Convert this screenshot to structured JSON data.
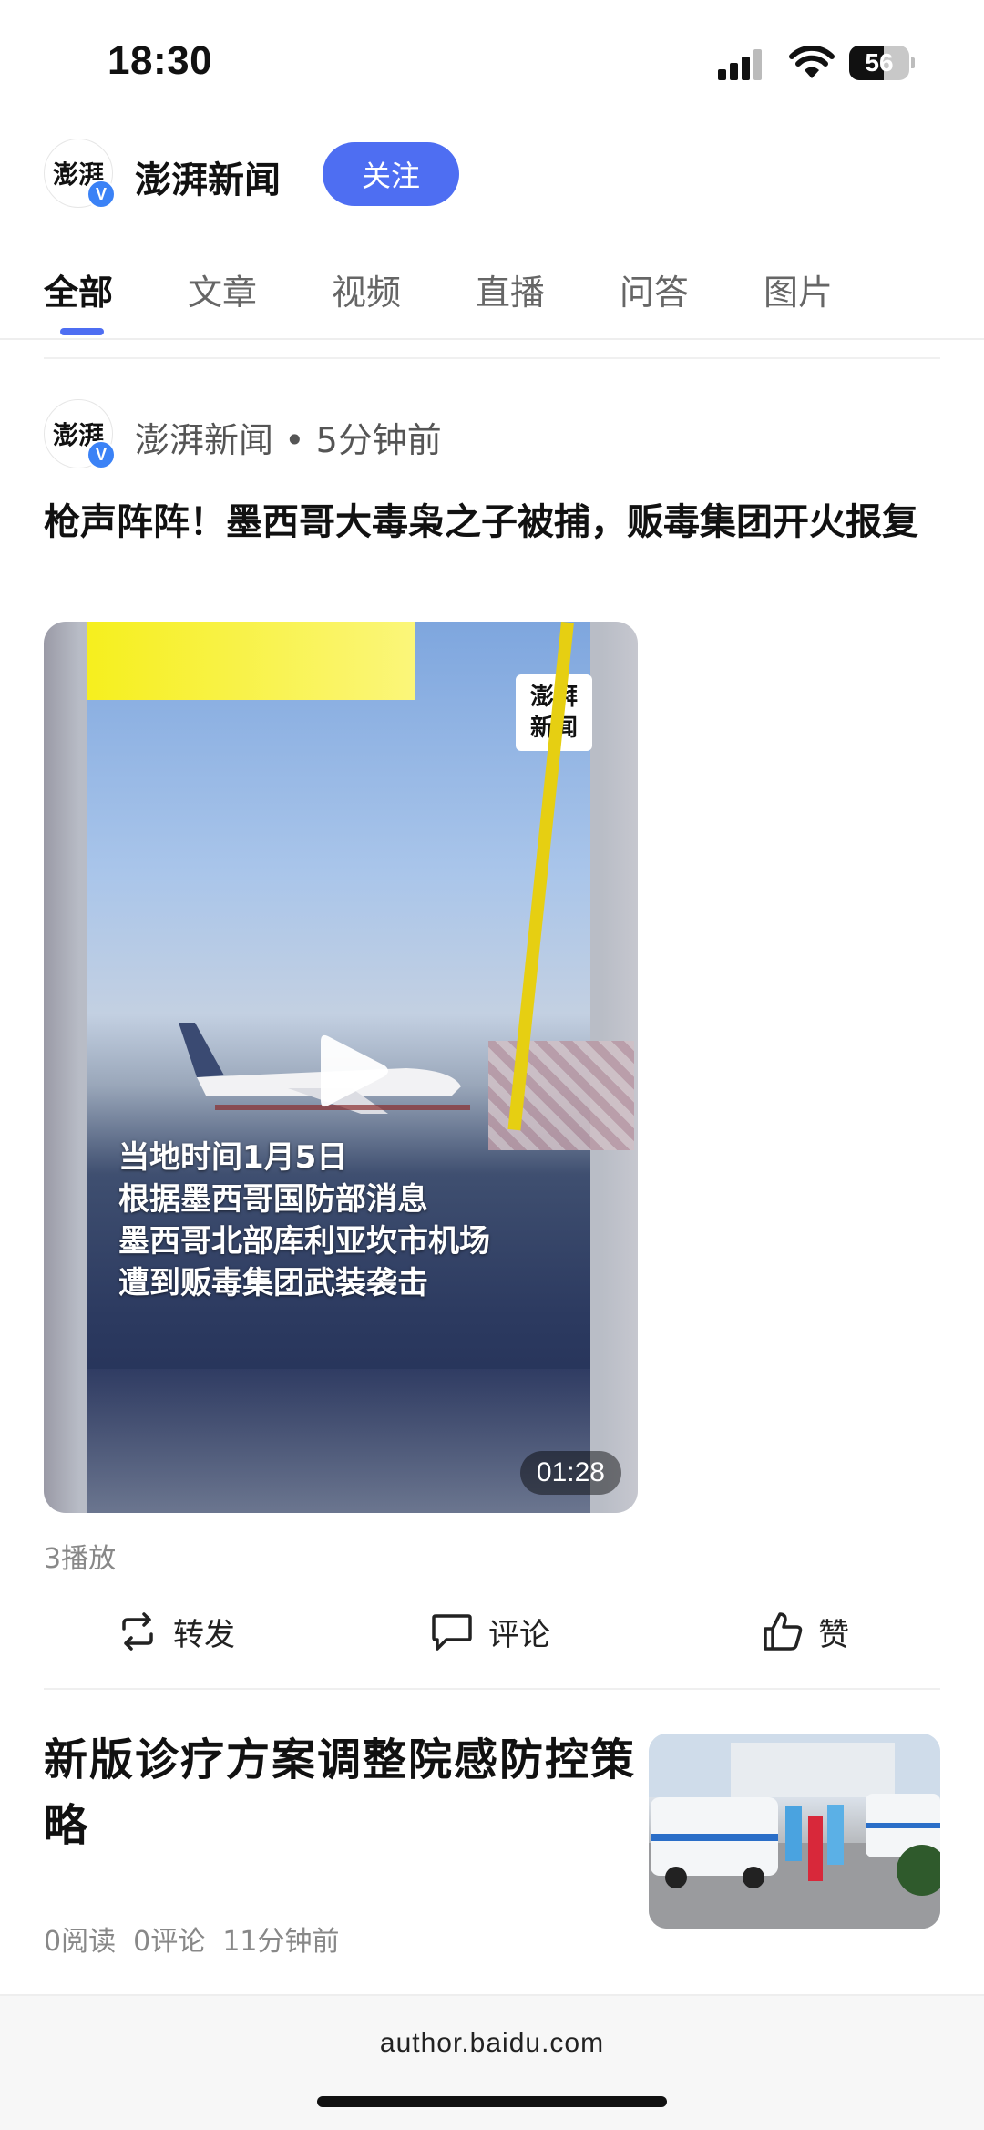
{
  "status_bar": {
    "time": "18:30",
    "battery": "56",
    "icons": [
      "signal-icon",
      "wifi-icon",
      "battery-icon"
    ]
  },
  "header": {
    "account_name": "澎湃新闻",
    "avatar_text": "澎湃",
    "follow_label": "关注"
  },
  "tabs": [
    {
      "label": "全部",
      "active": true
    },
    {
      "label": "文章",
      "active": false
    },
    {
      "label": "视频",
      "active": false
    },
    {
      "label": "直播",
      "active": false
    },
    {
      "label": "问答",
      "active": false
    },
    {
      "label": "图片",
      "active": false
    }
  ],
  "post": {
    "meta": "澎湃新闻 • 5分钟前",
    "title": "枪声阵阵！墨西哥大毒枭之子被捕，贩毒集团开火报复",
    "video": {
      "logo_text": "澎湃\n新闻",
      "captions": [
        "当地时间1月5日",
        "根据墨西哥国防部消息",
        "墨西哥北部库利亚坎市机场",
        "遭到贩毒集团武装袭击"
      ],
      "duration": "01:28"
    },
    "play_count": "3播放",
    "actions": {
      "forward": "转发",
      "comment": "评论",
      "like": "赞"
    }
  },
  "article2": {
    "title": "新版诊疗方案调整院感防控策略",
    "meta": "0阅读  0评论  11分钟前"
  },
  "bottom": {
    "url": "author.baidu.com"
  },
  "colors": {
    "accent": "#4e6ef2",
    "verified": "#3b82f6"
  }
}
